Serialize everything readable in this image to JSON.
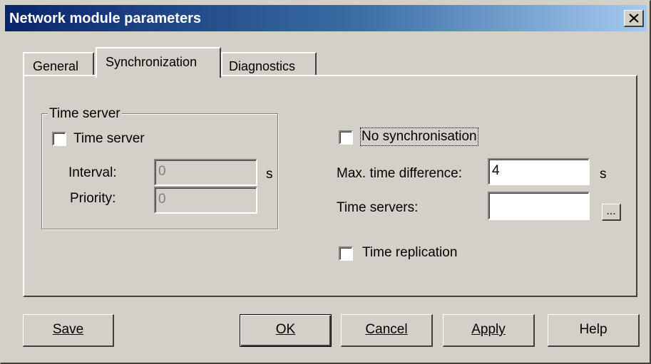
{
  "window": {
    "title": "Network module parameters"
  },
  "tabs": [
    {
      "label": "General"
    },
    {
      "label": "Synchronization"
    },
    {
      "label": "Diagnostics"
    }
  ],
  "time_server_group": {
    "legend": "Time server",
    "checkbox_label": "Time server",
    "checked": false,
    "interval_label": "Interval:",
    "interval_value": "0",
    "interval_unit": "s",
    "priority_label": "Priority:",
    "priority_value": "0"
  },
  "sync": {
    "no_sync_label": "No synchronisation",
    "no_sync_checked": false,
    "max_diff_label": "Max. time difference:",
    "max_diff_value": "4",
    "max_diff_unit": "s",
    "time_servers_label": "Time servers:",
    "time_servers_value": "",
    "browse_label": "...",
    "replication_label": "Time replication",
    "replication_checked": false
  },
  "buttons": {
    "save": "Save",
    "ok": "OK",
    "cancel": "Cancel",
    "apply": "Apply",
    "help": "Help"
  },
  "colors": {
    "title_gradient_start": "#0a246a",
    "title_gradient_end": "#a6caf0",
    "face": "#d4d0c8"
  }
}
